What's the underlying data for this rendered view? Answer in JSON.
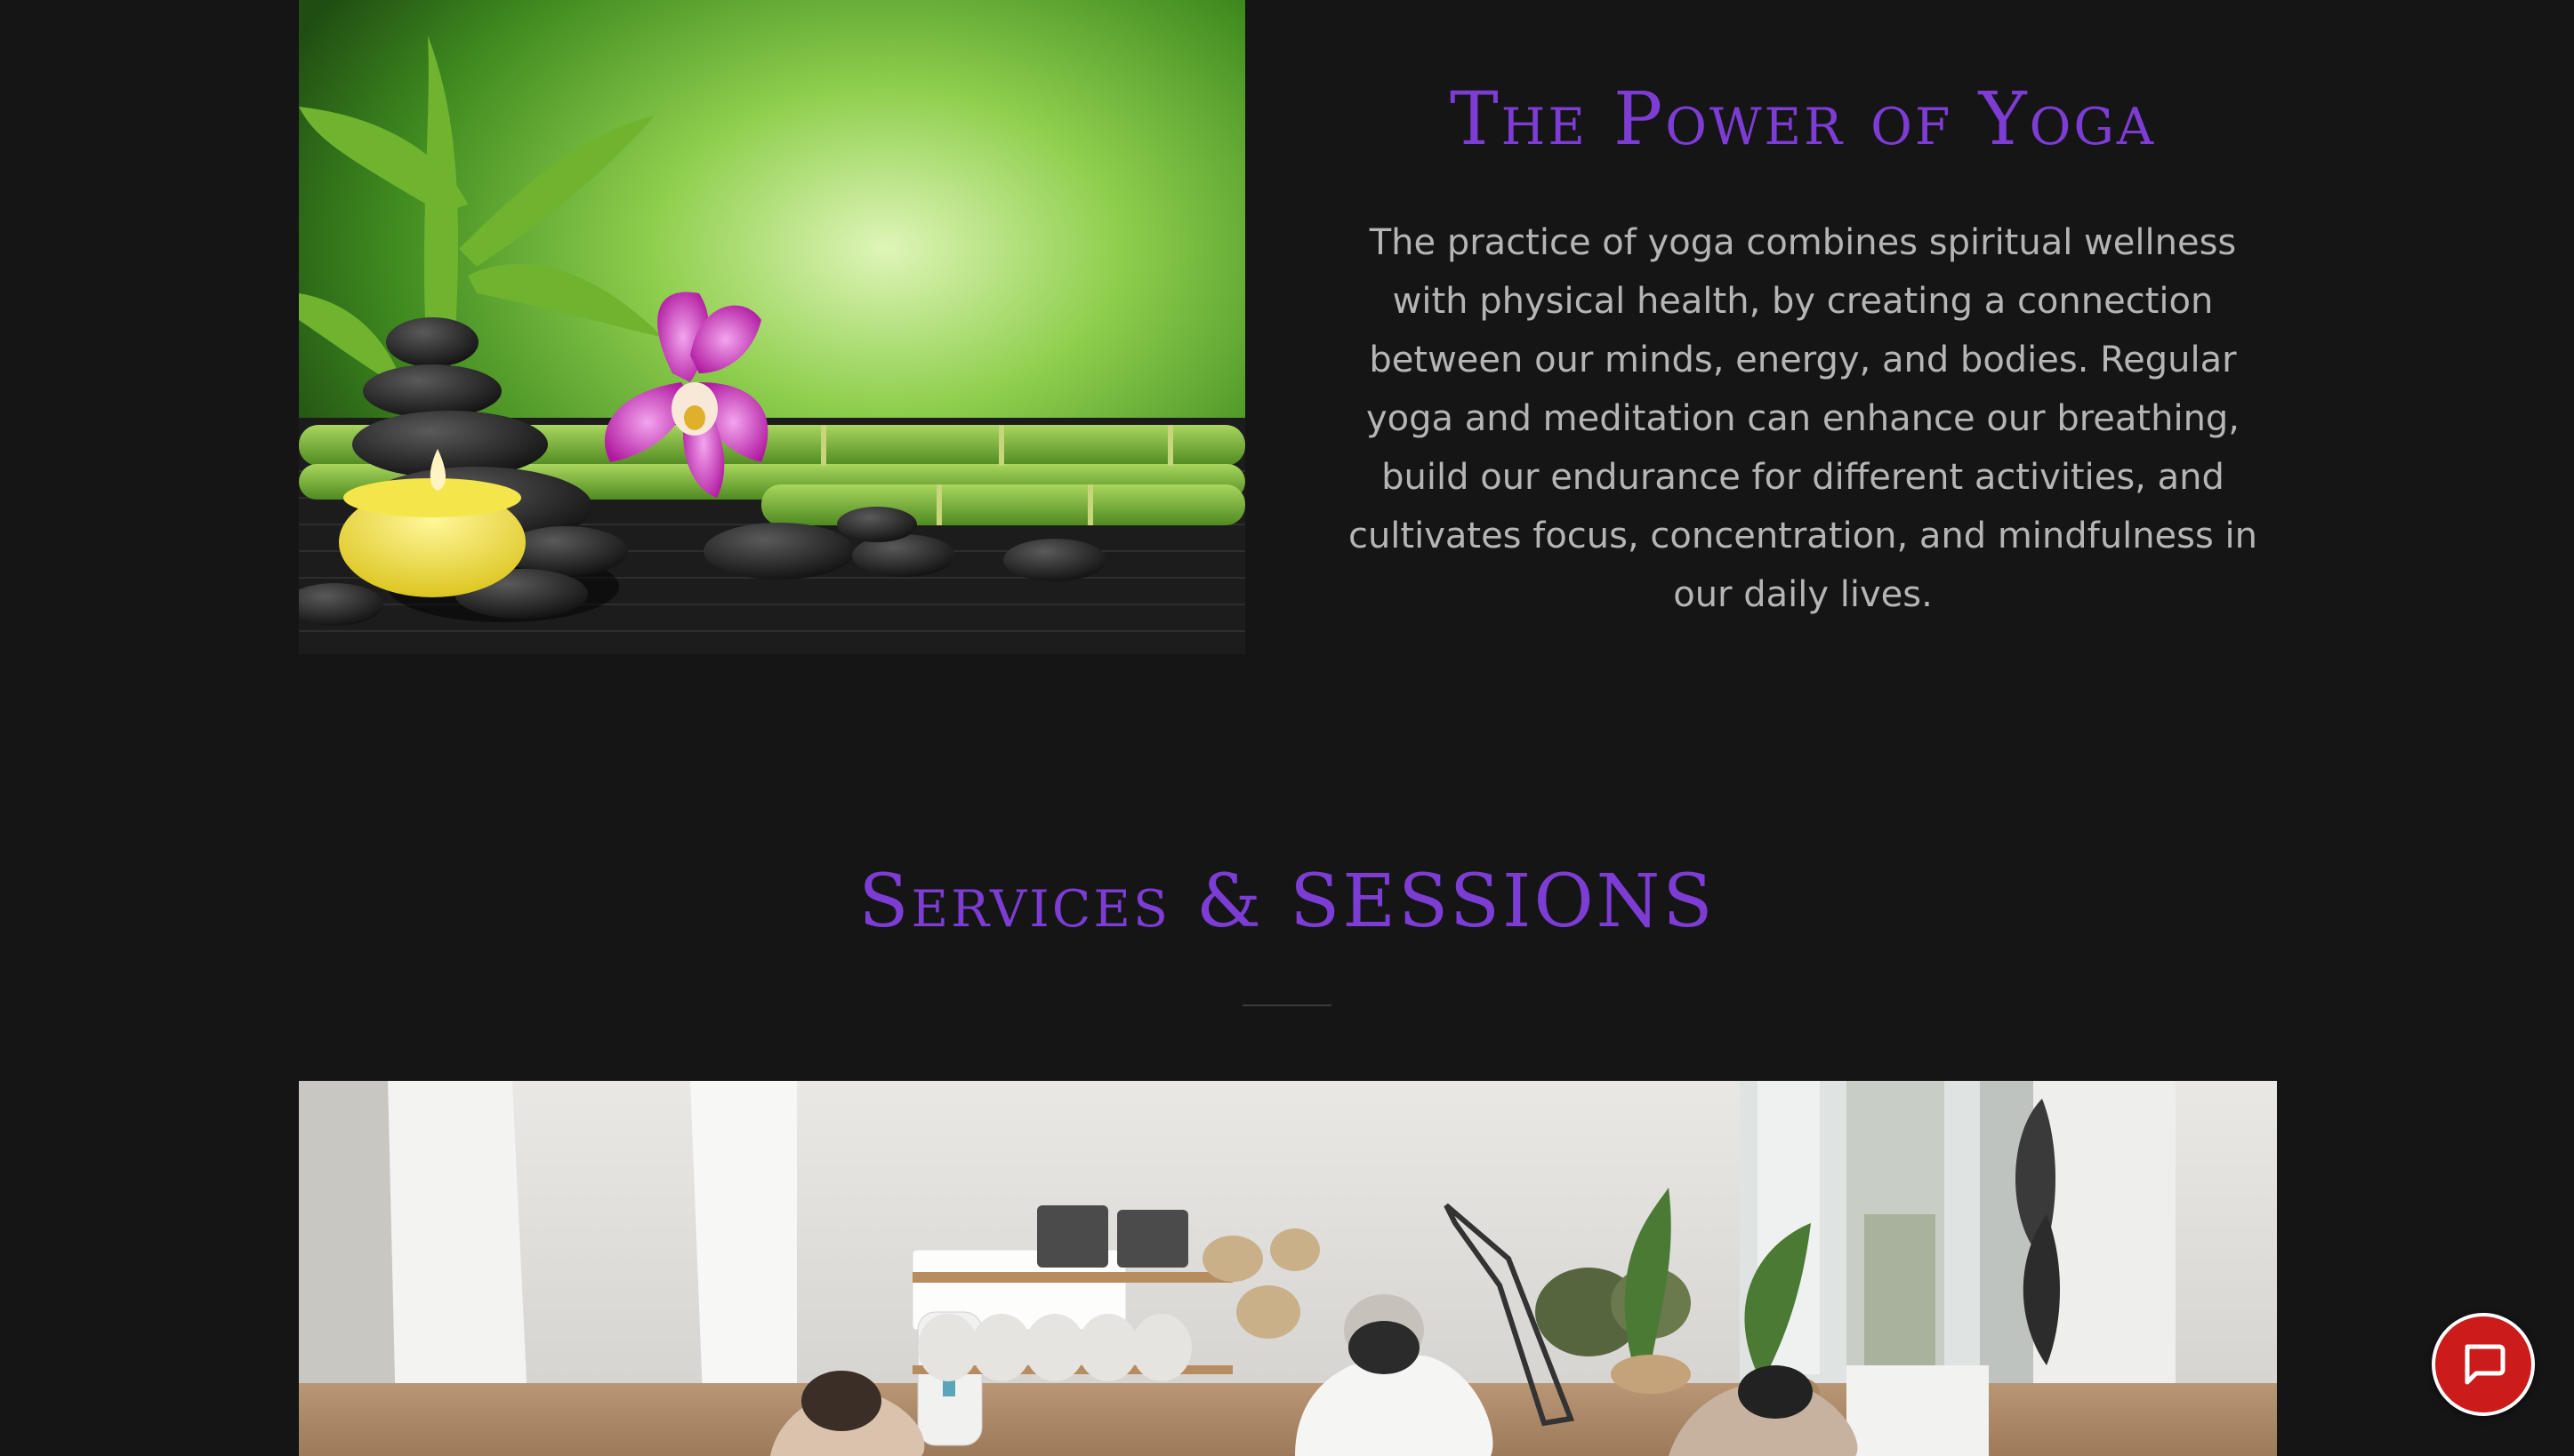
{
  "intro": {
    "title": "The Power of Yoga",
    "body": "The practice of yoga combines spiritual wellness with physical health, by creating a connection between our minds, energy, and bodies. Regular yoga and meditation can enhance our breathing, build our endurance for different activities, and cultivates focus, concentration, and mindfulness in our daily lives."
  },
  "services": {
    "title": "Services & SESSIONS"
  },
  "images": {
    "zen": "zen-stones-bamboo-orchid-candle",
    "studio": "yoga-studio-class"
  },
  "chat": {
    "icon": "chat-bubble-icon"
  },
  "colors": {
    "background": "#151516",
    "accent": "#7d3cd4",
    "body_text": "#b5b5b5",
    "chat_button": "#cc1b1b"
  }
}
